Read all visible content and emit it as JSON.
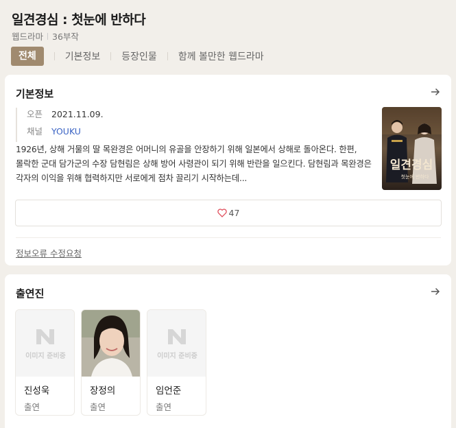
{
  "header": {
    "title": "일견경심 : 첫눈에 반하다",
    "genre": "웹드라마",
    "episodes": "36부작"
  },
  "tabs": [
    {
      "label": "전체",
      "active": true
    },
    {
      "label": "기본정보",
      "active": false
    },
    {
      "label": "등장인물",
      "active": false
    },
    {
      "label": "함께 볼만한 웹드라마",
      "active": false
    }
  ],
  "info": {
    "section_title": "기본정보",
    "open_label": "오픈",
    "open_value": "2021.11.09.",
    "channel_label": "채널",
    "channel_value": "YOUKU",
    "synopsis": "1926년, 상해 거물의 딸 목완경은 어머니의 유골을 안장하기 위해 일본에서 상해로 돌아온다. 한편, 몰락한 군대 담가군의 수장 담현림은 상해 방어 사령관이 되기 위해 반란을 일으킨다. 담현림과 목완경은 각자의 이익을 위해 협력하지만 서로에게 점차 끌리기 시작하는데...",
    "poster_title": "일견경심",
    "poster_subtitle": "첫눈에 반하다",
    "likes": "47",
    "report_label": "정보오류 수정요청"
  },
  "cast": {
    "section_title": "출연진",
    "placeholder_text": "이미지 준비중",
    "members": [
      {
        "name": "진성욱",
        "role": "출연",
        "has_photo": false
      },
      {
        "name": "장정의",
        "role": "출연",
        "has_photo": true
      },
      {
        "name": "임언준",
        "role": "출연",
        "has_photo": false
      }
    ]
  },
  "colors": {
    "accent": "#a08a6f",
    "link": "#3a63c4",
    "background": "#f2efea"
  }
}
